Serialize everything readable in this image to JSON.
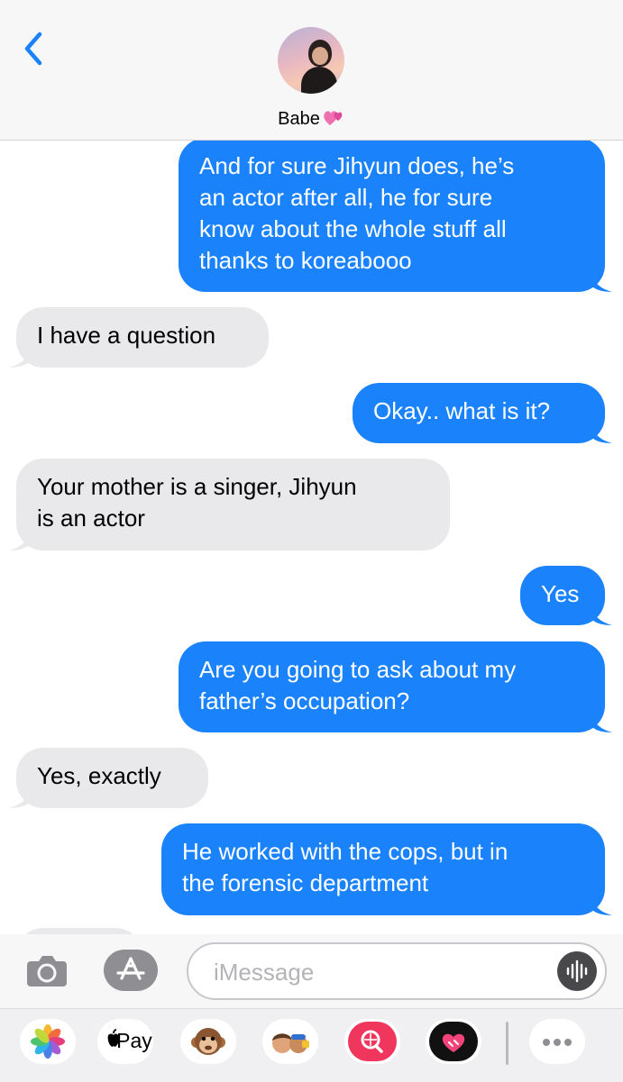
{
  "header": {
    "contact_name": "Babe",
    "back_icon": "chevron-left-icon",
    "avatar_icon": "contact-avatar",
    "name_emoji_icon": "two-hearts-icon"
  },
  "messages": [
    {
      "from": "me",
      "lines": [
        "And for sure Jihyun does, he’s",
        "an actor after all, he for sure",
        "know about the whole stuff all",
        "thanks to koreabooo"
      ]
    },
    {
      "from": "them",
      "lines": [
        "I have a question"
      ]
    },
    {
      "from": "me",
      "lines": [
        "Okay.. what is it?"
      ]
    },
    {
      "from": "them",
      "lines": [
        "Your mother is a singer, Jihyun",
        "is an actor"
      ]
    },
    {
      "from": "me",
      "lines": [
        "Yes"
      ]
    },
    {
      "from": "me",
      "lines": [
        "Are you going to ask about my",
        "father’s occupation?"
      ]
    },
    {
      "from": "them",
      "lines": [
        "Yes, exactly"
      ]
    },
    {
      "from": "me",
      "lines": [
        "He worked with the cops, but in",
        "the forensic department"
      ]
    }
  ],
  "input": {
    "placeholder": "iMessage",
    "value": "",
    "camera_icon": "camera-icon",
    "app_store_icon": "app-store-icon",
    "audio_icon": "audio-waveform-icon"
  },
  "apps": [
    {
      "name": "photos-app-icon"
    },
    {
      "name": "apple-pay-app-icon",
      "label": "Pay"
    },
    {
      "name": "monkey-animoji-icon"
    },
    {
      "name": "memoji-stickers-icon"
    },
    {
      "name": "image-search-icon"
    },
    {
      "name": "digital-touch-heart-icon"
    },
    {
      "name": "more-apps-icon"
    }
  ],
  "colors": {
    "outgoing_bubble": "#1a82fb",
    "incoming_bubble": "#e9e9eb",
    "ios_blue": "#1a82fb"
  }
}
